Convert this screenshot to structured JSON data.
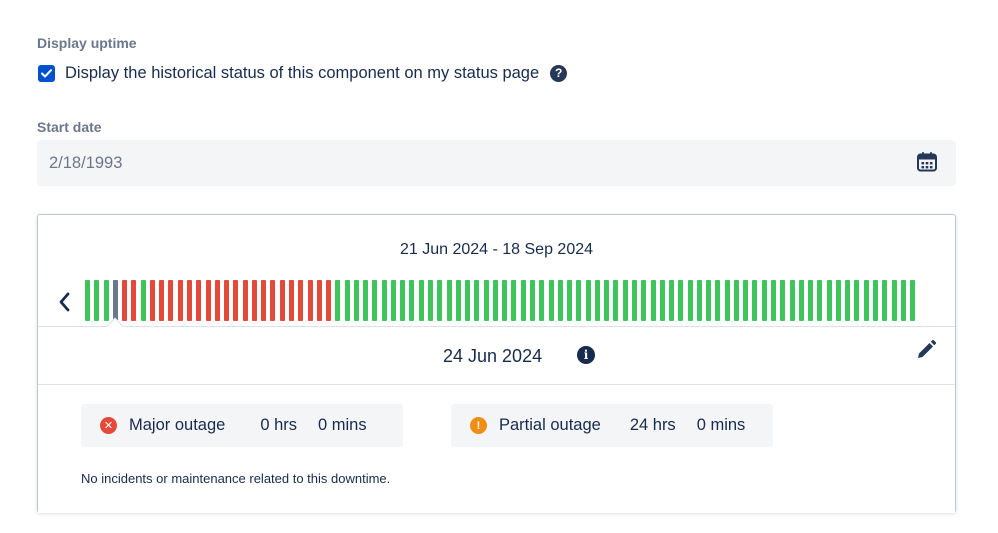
{
  "uptime": {
    "section_label": "Display uptime",
    "checkbox_label": "Display the historical status of this component on my status page",
    "checked": true,
    "help_icon": "question-circle-icon"
  },
  "start_date": {
    "label": "Start date",
    "value": "2/18/1993",
    "icon": "calendar-icon"
  },
  "history": {
    "range_label": "21 Jun 2024 - 18 Sep 2024",
    "prev_icon": "chevron-left-icon",
    "colors": {
      "operational": "#36b37e",
      "major": "#de350b",
      "selected": "#6b778c"
    },
    "days": [
      "operational",
      "operational",
      "operational",
      "selected",
      "major",
      "major",
      "operational",
      "major",
      "major",
      "major",
      "major",
      "major",
      "major",
      "major",
      "major",
      "major",
      "major",
      "major",
      "major",
      "major",
      "major",
      "major",
      "major",
      "major",
      "major",
      "major",
      "major",
      "operational",
      "operational",
      "operational",
      "operational",
      "operational",
      "operational",
      "operational",
      "operational",
      "operational",
      "operational",
      "operational",
      "operational",
      "operational",
      "operational",
      "operational",
      "operational",
      "operational",
      "operational",
      "operational",
      "operational",
      "operational",
      "operational",
      "operational",
      "operational",
      "operational",
      "operational",
      "operational",
      "operational",
      "operational",
      "operational",
      "operational",
      "operational",
      "operational",
      "operational",
      "operational",
      "operational",
      "operational",
      "operational",
      "operational",
      "operational",
      "operational",
      "operational",
      "operational",
      "operational",
      "operational",
      "operational",
      "operational",
      "operational",
      "operational",
      "operational",
      "operational",
      "operational",
      "operational",
      "operational",
      "operational",
      "operational",
      "operational",
      "operational",
      "operational",
      "operational",
      "operational",
      "operational",
      "operational"
    ]
  },
  "popup": {
    "date": "24 Jun 2024",
    "info_icon": "info-icon",
    "edit_icon": "pencil-icon",
    "major": {
      "label": "Major outage",
      "hrs": "0 hrs",
      "mins": "0 mins",
      "color": "#e5493a"
    },
    "partial": {
      "label": "Partial outage",
      "hrs": "24 hrs",
      "mins": "0 mins",
      "color": "#f18d13"
    },
    "note": "No incidents or maintenance related to this downtime."
  }
}
